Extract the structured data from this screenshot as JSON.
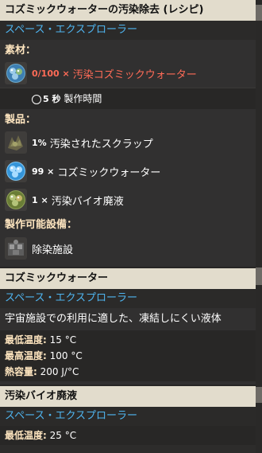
{
  "recipe": {
    "title": "コズミックウォーターの汚染除去 (レシピ)",
    "mod": "スペース・エクスプローラー",
    "ingredients_title": "素材：",
    "ingredients": [
      {
        "amount": "0/100 ×",
        "name": "汚染コズミックウォーター",
        "icon": "cosmic-water-contaminated-icon"
      }
    ],
    "time_value": "5 秒",
    "time_label": "製作時間",
    "products_title": "製品：",
    "products": [
      {
        "amount": "1%",
        "name": "汚染されたスクラップ",
        "icon": "contaminated-scrap-icon"
      },
      {
        "amount": "99 ×",
        "name": "コズミックウォーター",
        "icon": "cosmic-water-icon"
      },
      {
        "amount": "1 ×",
        "name": "汚染バイオ廃液",
        "icon": "contaminated-bio-sludge-icon"
      }
    ],
    "made_in_title": "製作可能設備：",
    "made_in": [
      {
        "name": "除染施設",
        "icon": "decontamination-facility-icon"
      }
    ]
  },
  "cosmic_water": {
    "title": "コズミックウォーター",
    "mod": "スペース・エクスプローラー",
    "description": "宇宙施設での利用に適した、凍結しにくい液体",
    "stats": [
      {
        "key": "最低温度:",
        "value": "15 °C"
      },
      {
        "key": "最高温度:",
        "value": "100 °C"
      },
      {
        "key": "熱容量:",
        "value": "200 J/°C"
      }
    ]
  },
  "bio_sludge": {
    "title": "汚染バイオ廃液",
    "mod": "スペース・エクスプローラー",
    "stats": [
      {
        "key": "最低温度:",
        "value": "25 °C"
      }
    ]
  },
  "colors": {
    "header_bg": "#e2dccc",
    "mod_blue": "#4fb5f0",
    "section_peach": "#ffe6c0",
    "missing_red": "#ff6b57"
  }
}
